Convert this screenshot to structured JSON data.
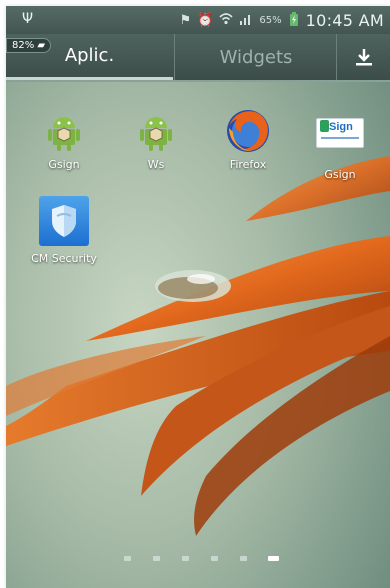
{
  "status": {
    "left_icon": "usb-icon",
    "icons": [
      "notification-icon",
      "alarm-icon",
      "wifi-icon",
      "signal-icon"
    ],
    "battery_text": "65%",
    "time": "10:45 AM"
  },
  "battery_chip": "82%",
  "tabs": {
    "apps_label": "Aplic.",
    "widgets_label": "Widgets",
    "download_icon": "download-icon"
  },
  "apps": [
    {
      "label": "Gsign",
      "icon": "android-icon"
    },
    {
      "label": "Ws",
      "icon": "android-icon"
    },
    {
      "label": "Firefox",
      "icon": "firefox-icon"
    },
    {
      "label": "Gsign",
      "icon": "gsign-logo-icon",
      "logo_text": "Sign"
    },
    {
      "label": "CM Security",
      "icon": "shield-icon"
    }
  ],
  "page_indicator": {
    "count": 6,
    "active": 6
  }
}
